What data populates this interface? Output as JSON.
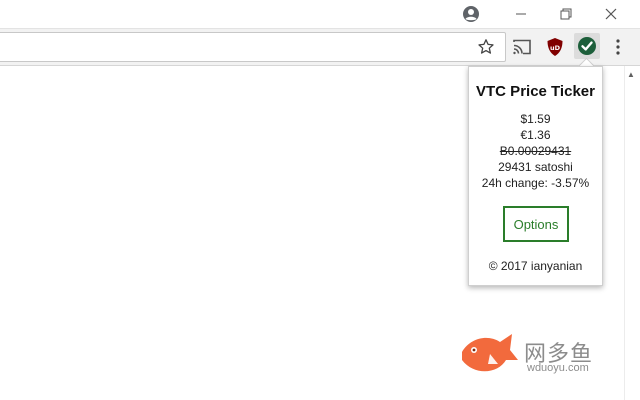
{
  "browser": {
    "profile_icon": "account-circle-icon",
    "window_controls": [
      "minimize-icon",
      "restore-icon",
      "close-icon"
    ],
    "toolbar_icons": [
      "star-icon",
      "cast-icon",
      "ublock-icon",
      "vtc-checkmark-icon",
      "menu-icon"
    ],
    "ublock_label": "uD"
  },
  "popup": {
    "title": "VTC Price Ticker",
    "usd": "$1.59",
    "eur": "€1.36",
    "btc": "B0.00029431",
    "satoshi": "29431 satoshi",
    "change": "24h change: -3.57%",
    "options_label": "Options",
    "footer": "© 2017 ianyanian"
  },
  "watermark": {
    "chinese": "网多鱼",
    "url": "wduoyu.com"
  },
  "colors": {
    "accent_green": "#2a7d2a",
    "watermark_orange": "#f26a3d"
  }
}
